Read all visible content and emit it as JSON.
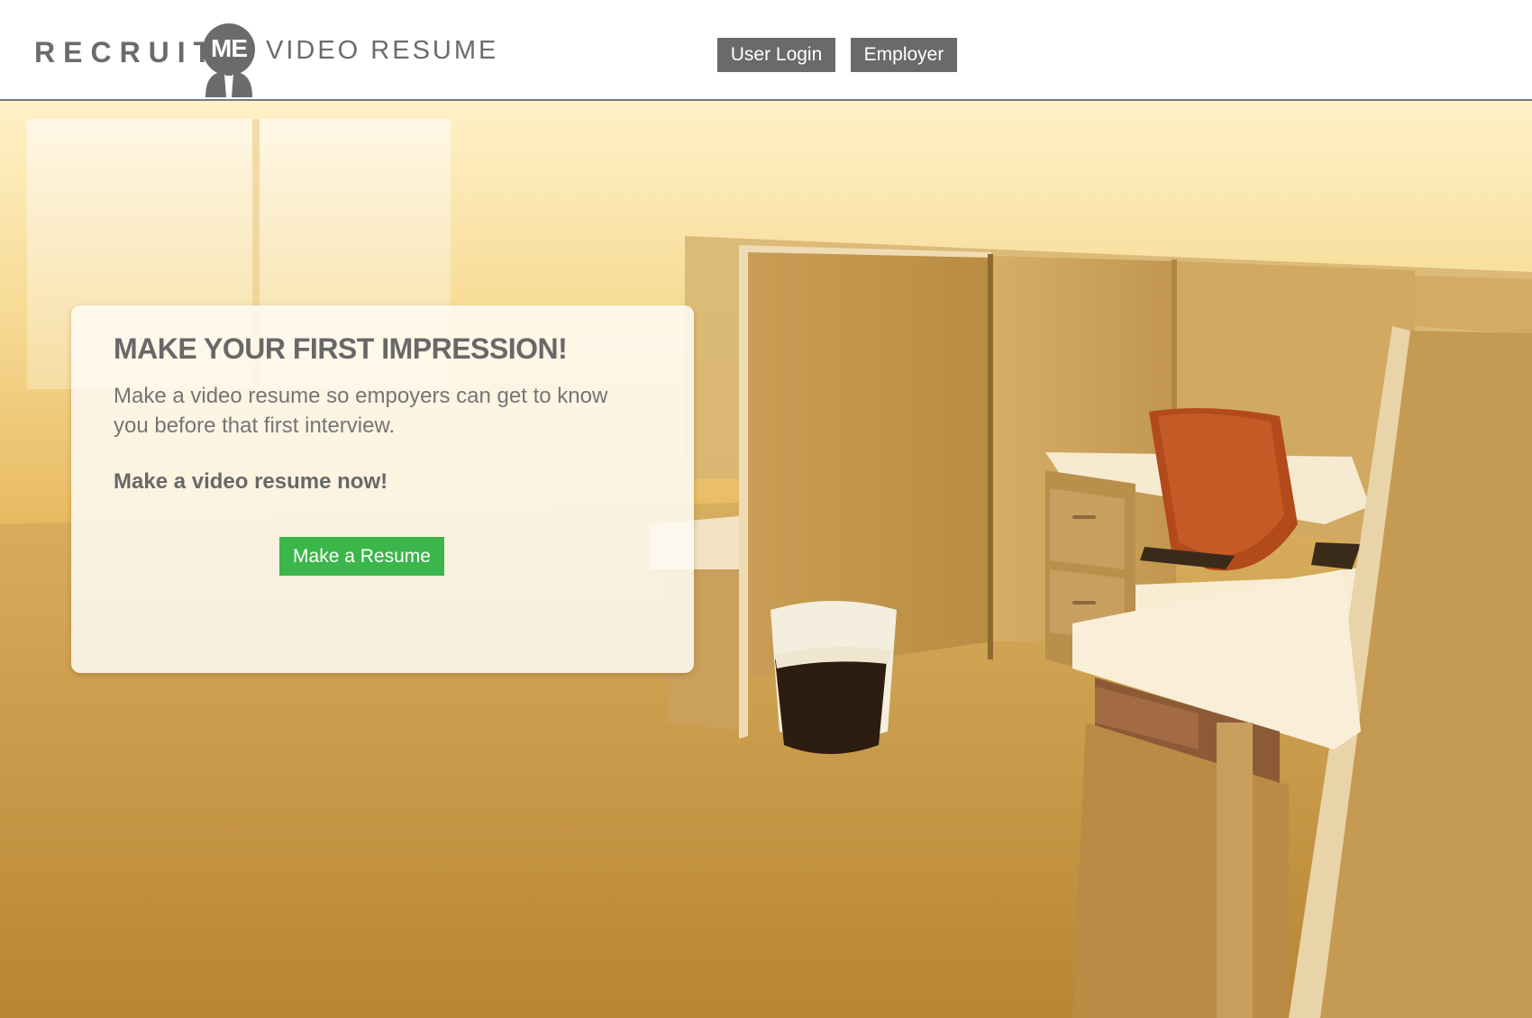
{
  "brand": {
    "name_part1": "RECRUIT",
    "name_badge": "ME",
    "tagline": "VIDEO RESUME",
    "text_color": "#6b6b6b"
  },
  "nav": {
    "user_login": "User Login",
    "employer": "Employer",
    "button_color": "#6a6a6a"
  },
  "hero": {
    "image_icon": "office-cubicle-photo",
    "card": {
      "title": "MAKE YOUR FIRST IMPRESSION!",
      "description": "Make a video resume so empoyers can get to know you before that first interview.",
      "cta_text": "Make a video resume now!",
      "button_label": "Make a Resume",
      "button_color": "#3bb64a"
    }
  }
}
